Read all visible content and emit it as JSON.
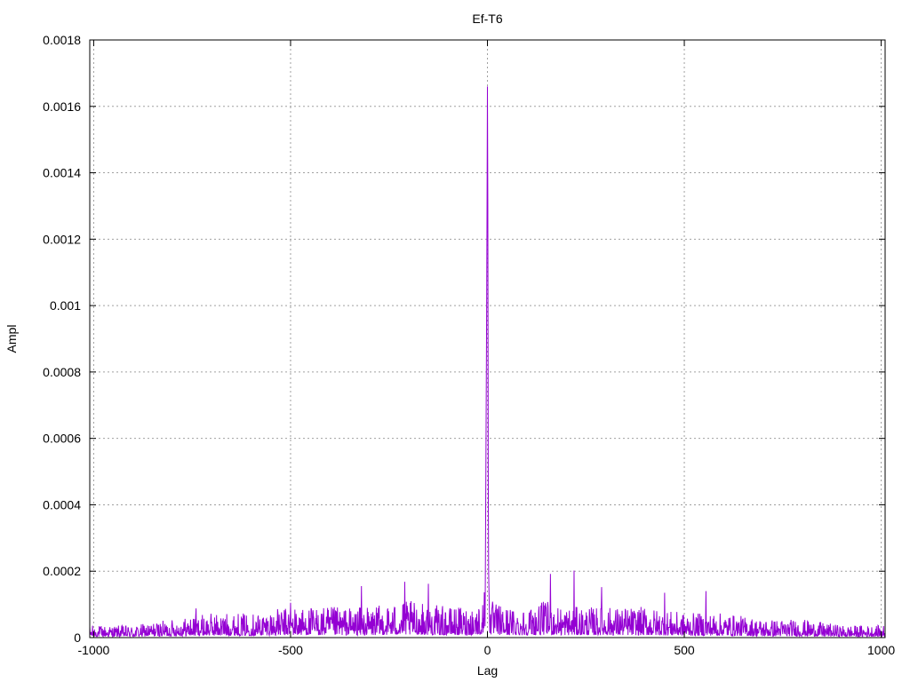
{
  "chart_data": {
    "type": "line",
    "title": "Ef-T6",
    "xlabel": "Lag",
    "ylabel": "Ampl",
    "xlim": [
      -1010,
      1010
    ],
    "ylim": [
      0,
      0.0018
    ],
    "x_ticks": [
      -1000,
      -500,
      0,
      500,
      1000
    ],
    "x_tick_labels": [
      "-1000",
      "-500",
      "0",
      "500",
      "1000"
    ],
    "y_ticks": [
      0,
      0.0002,
      0.0004,
      0.0006,
      0.0008,
      0.001,
      0.0012,
      0.0014,
      0.0016,
      0.0018
    ],
    "y_tick_labels": [
      "0",
      "0.0002",
      "0.0004",
      "0.0006",
      "0.0008",
      "0.001",
      "0.0012",
      "0.0014",
      "0.0016",
      "0.0018"
    ],
    "grid": true,
    "line_color": "#9400d3",
    "series": [
      {
        "x": [
          -1010,
          -900,
          -800,
          -700,
          -600,
          -500,
          -400,
          -300,
          -200,
          -100,
          -50,
          -10,
          -5,
          -2,
          -1,
          0,
          1,
          2,
          3,
          5,
          10,
          50,
          100,
          150,
          200,
          300,
          400,
          500,
          600,
          700,
          800,
          900,
          1010
        ],
        "values": [
          2e-05,
          2e-05,
          3e-05,
          4e-05,
          4e-05,
          5e-05,
          5e-05,
          5e-05,
          6e-05,
          5e-05,
          5e-05,
          6e-05,
          0.00025,
          0.00098,
          0.0013,
          0.00166,
          0.0013,
          0.00051,
          0.0002,
          7e-05,
          6e-05,
          5e-05,
          5e-05,
          6e-05,
          5e-05,
          5e-05,
          5e-05,
          4e-05,
          4e-05,
          3e-05,
          3e-05,
          2e-05,
          2e-05
        ],
        "peaks": [
          {
            "x": -740,
            "y": 8.8e-05
          },
          {
            "x": -500,
            "y": 0.000105
          },
          {
            "x": -320,
            "y": 0.000155
          },
          {
            "x": -210,
            "y": 0.000168
          },
          {
            "x": -150,
            "y": 0.000162
          },
          {
            "x": 160,
            "y": 0.000192
          },
          {
            "x": 220,
            "y": 0.000202
          },
          {
            "x": 290,
            "y": 0.000152
          },
          {
            "x": 450,
            "y": 0.000135
          },
          {
            "x": 555,
            "y": 0.00014
          }
        ]
      }
    ]
  }
}
